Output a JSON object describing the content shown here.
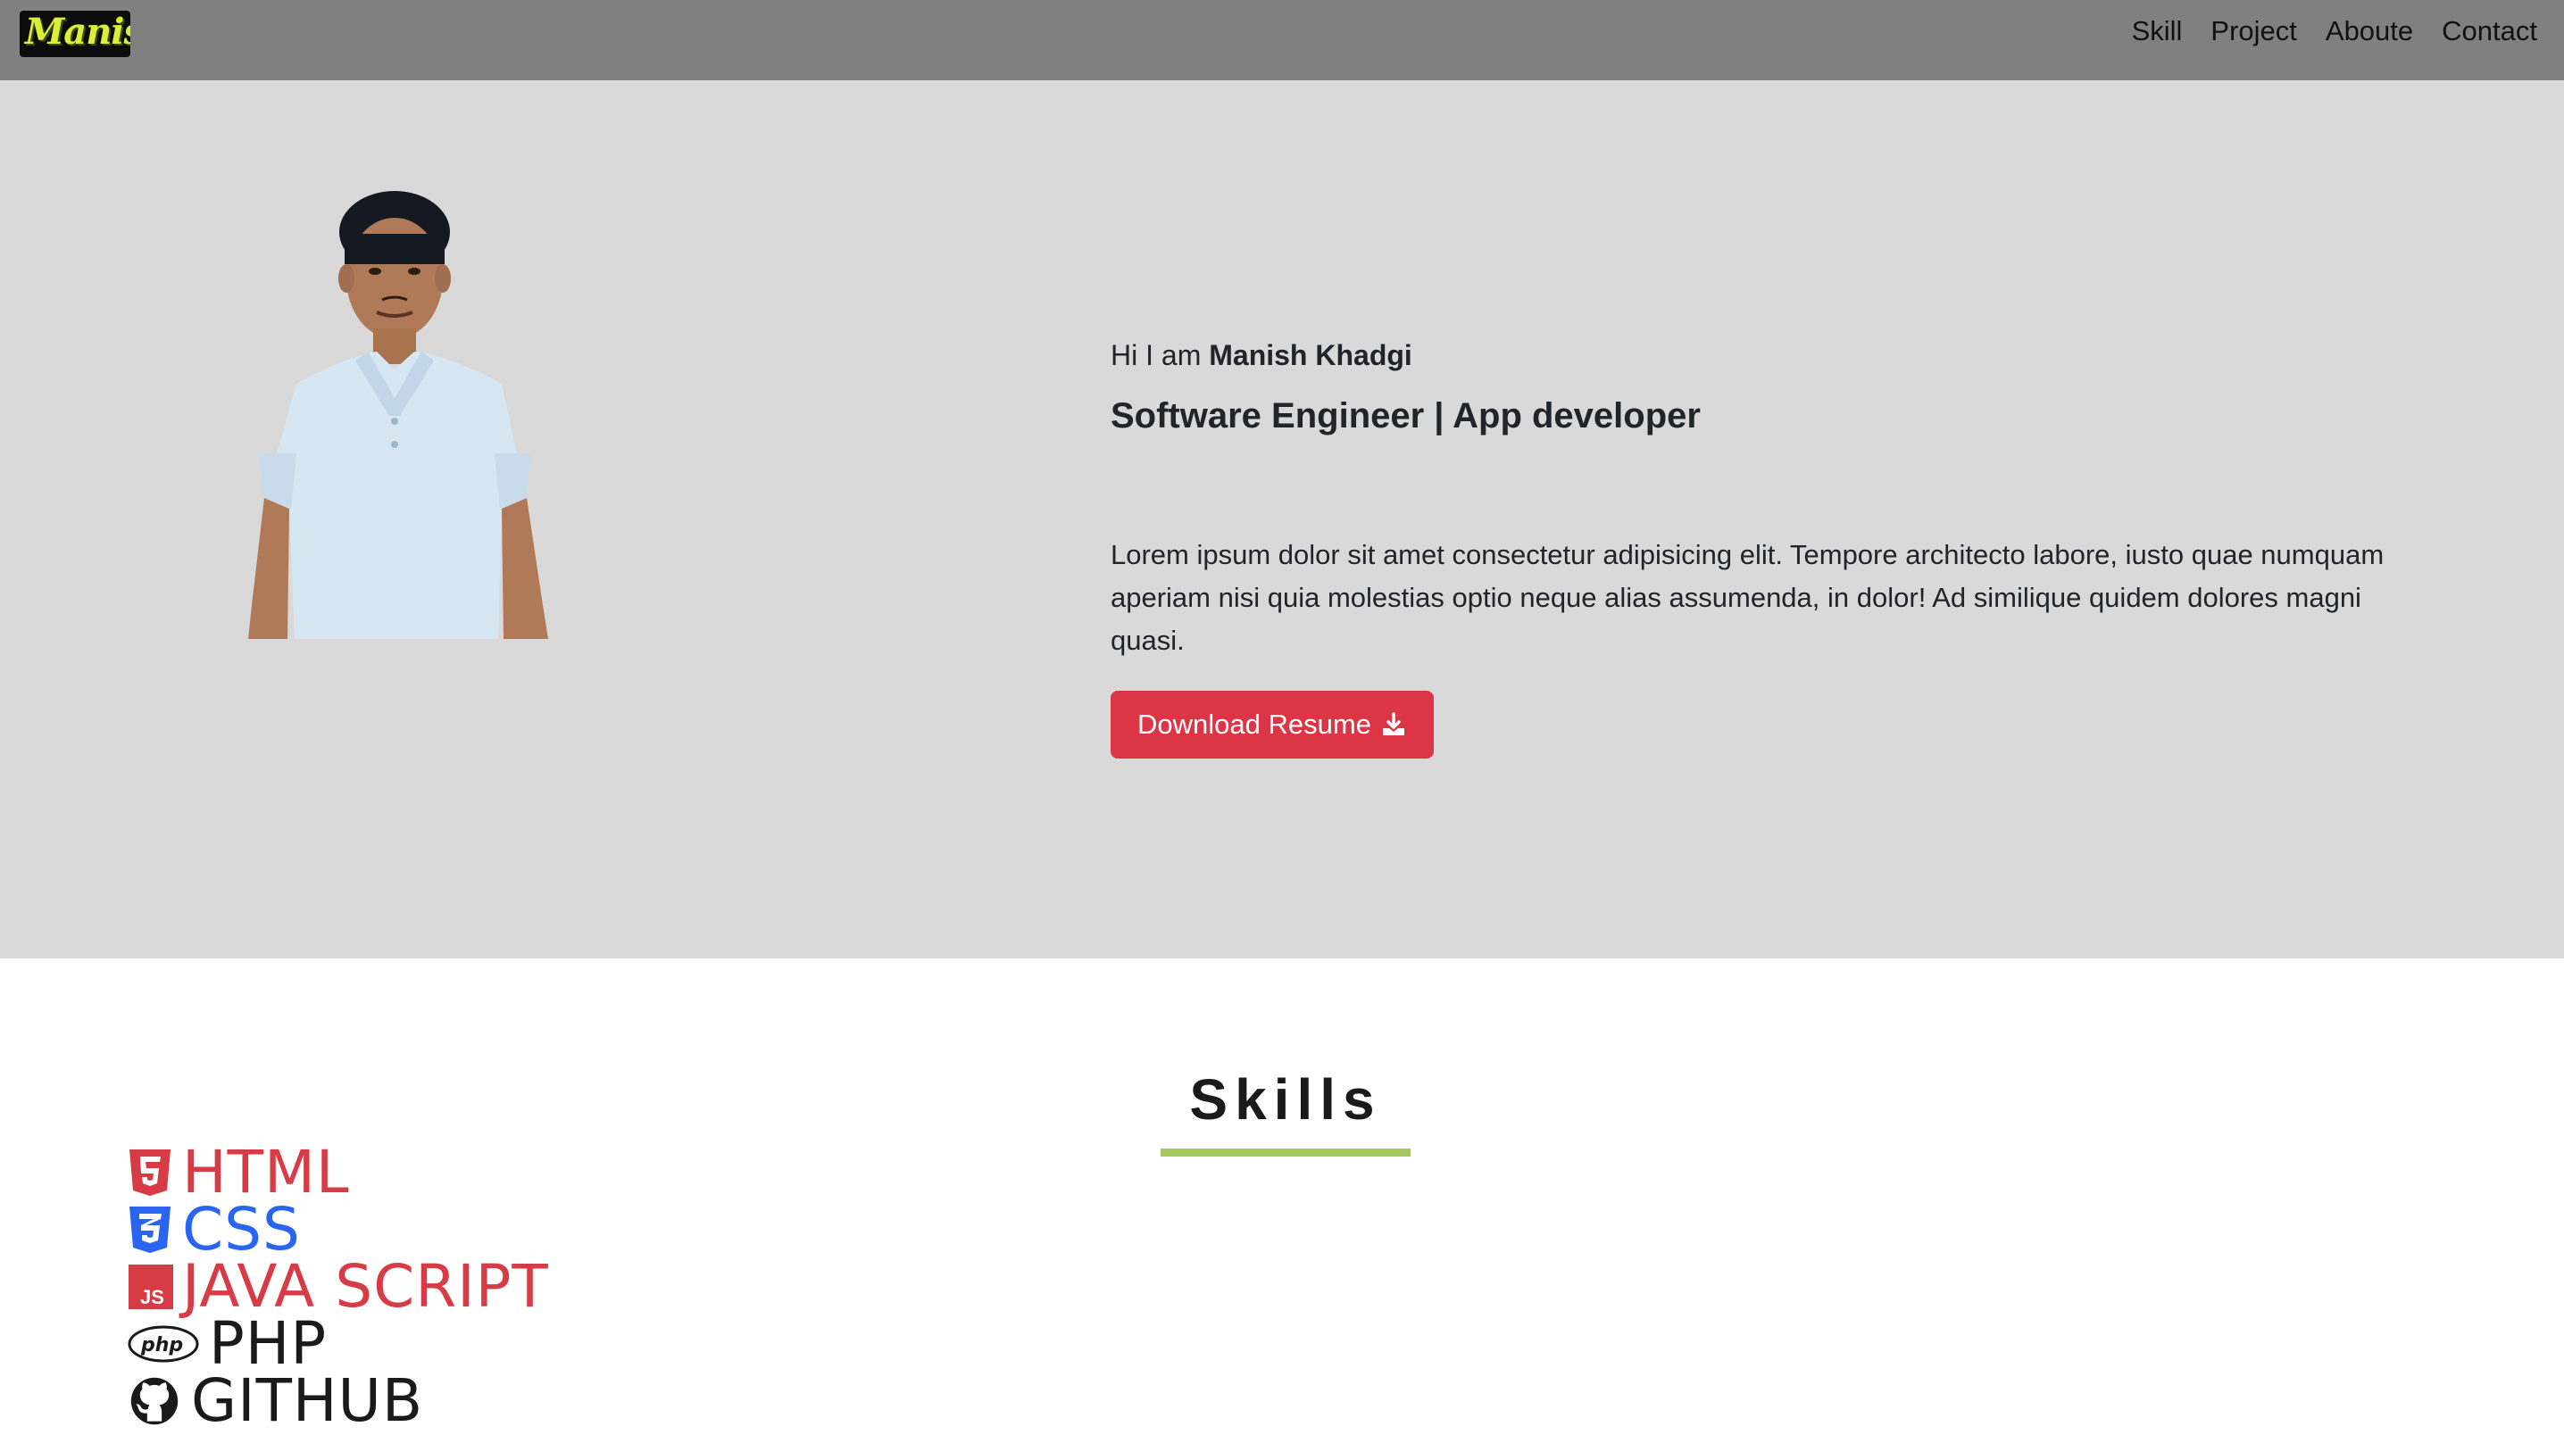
{
  "navbar": {
    "brand": "Manish",
    "links": [
      {
        "label": "Skill"
      },
      {
        "label": "Project"
      },
      {
        "label": "Aboute"
      },
      {
        "label": "Contact"
      }
    ]
  },
  "hero": {
    "greeting": "Hi I am ",
    "name": "Manish Khadgi",
    "headline": "Software Engineer | App developer",
    "bio": "Lorem ipsum dolor sit amet consectetur adipisicing elit. Tempore architecto labore, iusto quae numquam aperiam nisi quia molestias optio neque alias assumenda, in dolor! Ad similique quidem dolores magni quasi.",
    "download_label": "Download Resume"
  },
  "skills": {
    "title": "Skills",
    "items": [
      {
        "label": "HTML",
        "icon": "html5-icon",
        "color": "#d63b46"
      },
      {
        "label": "CSS",
        "icon": "css3-icon",
        "color": "#2965f1"
      },
      {
        "label": "JAVA SCRIPT",
        "icon": "javascript-icon",
        "color": "#d63b46"
      },
      {
        "label": "PHP",
        "icon": "php-icon",
        "color": "#1a1a1a"
      },
      {
        "label": "GITHUB",
        "icon": "github-icon",
        "color": "#1a1a1a"
      }
    ]
  },
  "colors": {
    "navbar": "#808080",
    "hero_bg": "#d9d9d9",
    "button": "#dc3545",
    "underline": "#a4c95a"
  }
}
